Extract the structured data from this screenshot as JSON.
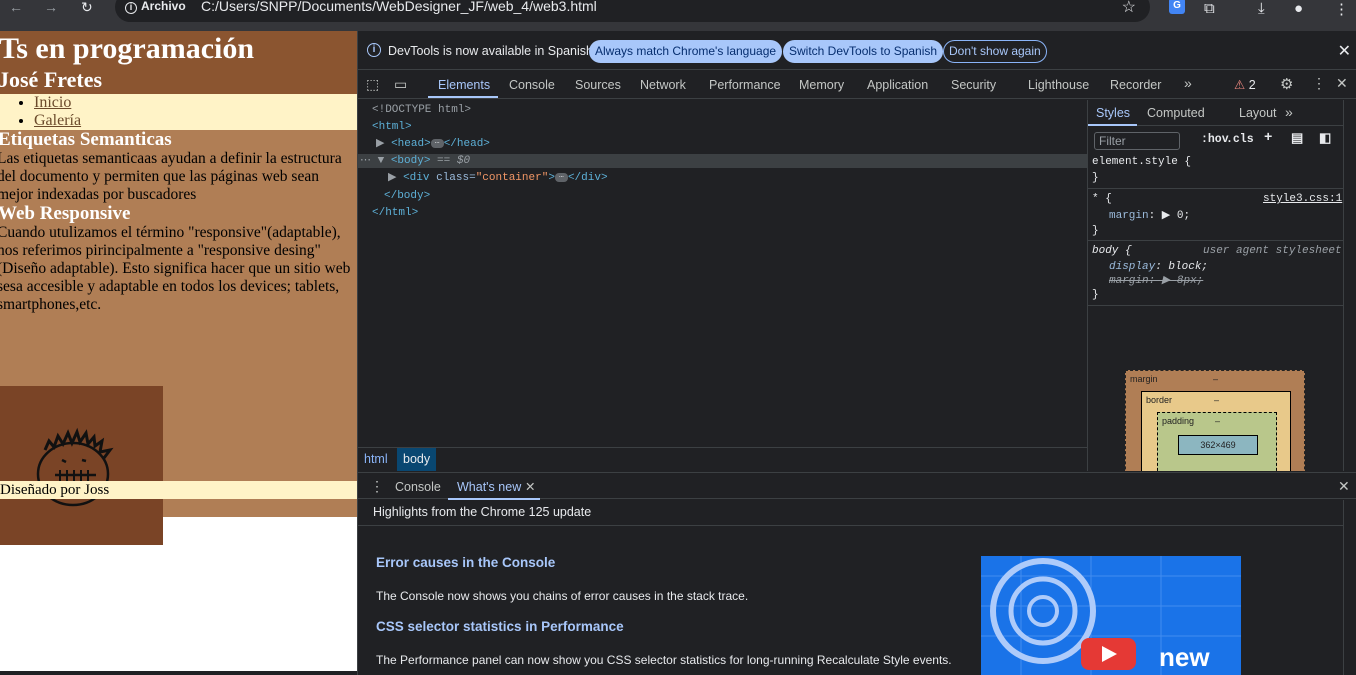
{
  "browser": {
    "back_icon": "arrow-left-icon",
    "forward_icon": "arrow-right-icon",
    "reload_icon": "reload-icon",
    "scheme_label": "Archivo",
    "url": "C:/Users/SNPP/Documents/WebDesigner_JF/web_4/web3.html",
    "bookmark_icon": "star-icon"
  },
  "page": {
    "title": "Ts en programación",
    "author": "José Fretes",
    "nav": [
      "Inicio",
      "Galería"
    ],
    "sections": [
      {
        "heading": "Etiquetas Semanticas",
        "text": "Las etiquetas semanticaas ayudan a definir la estructura del documento y permiten que las páginas web sean mejor indexadas por buscadores"
      },
      {
        "heading": "Web Responsive",
        "text": "Cuando utulizamos el término \"responsive\"(adaptable), nos referimos pirincipalmente a \"responsive desing\" (Diseño adaptable). Esto significa hacer que un sitio web sesa accesible y adaptable en todos los devices; tablets, smartphones,etc."
      }
    ],
    "footer": "Diseñado por Joss"
  },
  "devtools": {
    "infobar": {
      "message": "DevTools is now available in Spanish!",
      "btn_match": "Always match Chrome's language",
      "btn_switch": "Switch DevTools to Spanish",
      "btn_dismiss": "Don't show again"
    },
    "tabs": [
      "Elements",
      "Console",
      "Sources",
      "Network",
      "Performance",
      "Memory",
      "Application",
      "Security",
      "Lighthouse",
      "Recorder"
    ],
    "more_tabs": "»",
    "warnings": "2",
    "dom": {
      "doctype": "<!DOCTYPE html>",
      "html_open": "<html>",
      "head": "<head>",
      "head_close": "</head>",
      "body": "<body>",
      "body_marker": "== $0",
      "div_open": "<div ",
      "div_attr": "class=",
      "div_val": "\"container\"",
      "div_close": "</div>",
      "body_close": "</body>",
      "html_close": "</html>"
    },
    "breadcrumbs": [
      "html",
      "body"
    ],
    "styles": {
      "tabs": [
        "Styles",
        "Computed",
        "Layout"
      ],
      "filter_placeholder": "Filter",
      "hov": ":hov",
      "cls": ".cls",
      "element_style": "element.style {",
      "close_brace": "}",
      "rule1_selector": "* {",
      "rule1_source": "style3.css:1",
      "rule1_prop": "margin",
      "rule1_val": "0;",
      "rule2_selector": "body {",
      "rule2_source": "user agent stylesheet",
      "rule2_prop1": "display",
      "rule2_val1": "block;",
      "rule2_prop2": "margin",
      "rule2_val2": "8px;"
    },
    "boxmodel": {
      "margin": "margin",
      "border": "border",
      "padding": "padding",
      "dash": "–",
      "content": "362×469"
    },
    "drawer": {
      "tabs": [
        "Console",
        "What's new"
      ],
      "header": "Highlights from the Chrome 125 update",
      "items": [
        {
          "title": "Error causes in the Console",
          "body": "The Console now shows you chains of error causes in the stack trace."
        },
        {
          "title": "CSS selector statistics in Performance",
          "body": "The Performance panel can now show you CSS selector statistics for long-running Recalculate Style events."
        }
      ],
      "video_label": "new"
    }
  }
}
